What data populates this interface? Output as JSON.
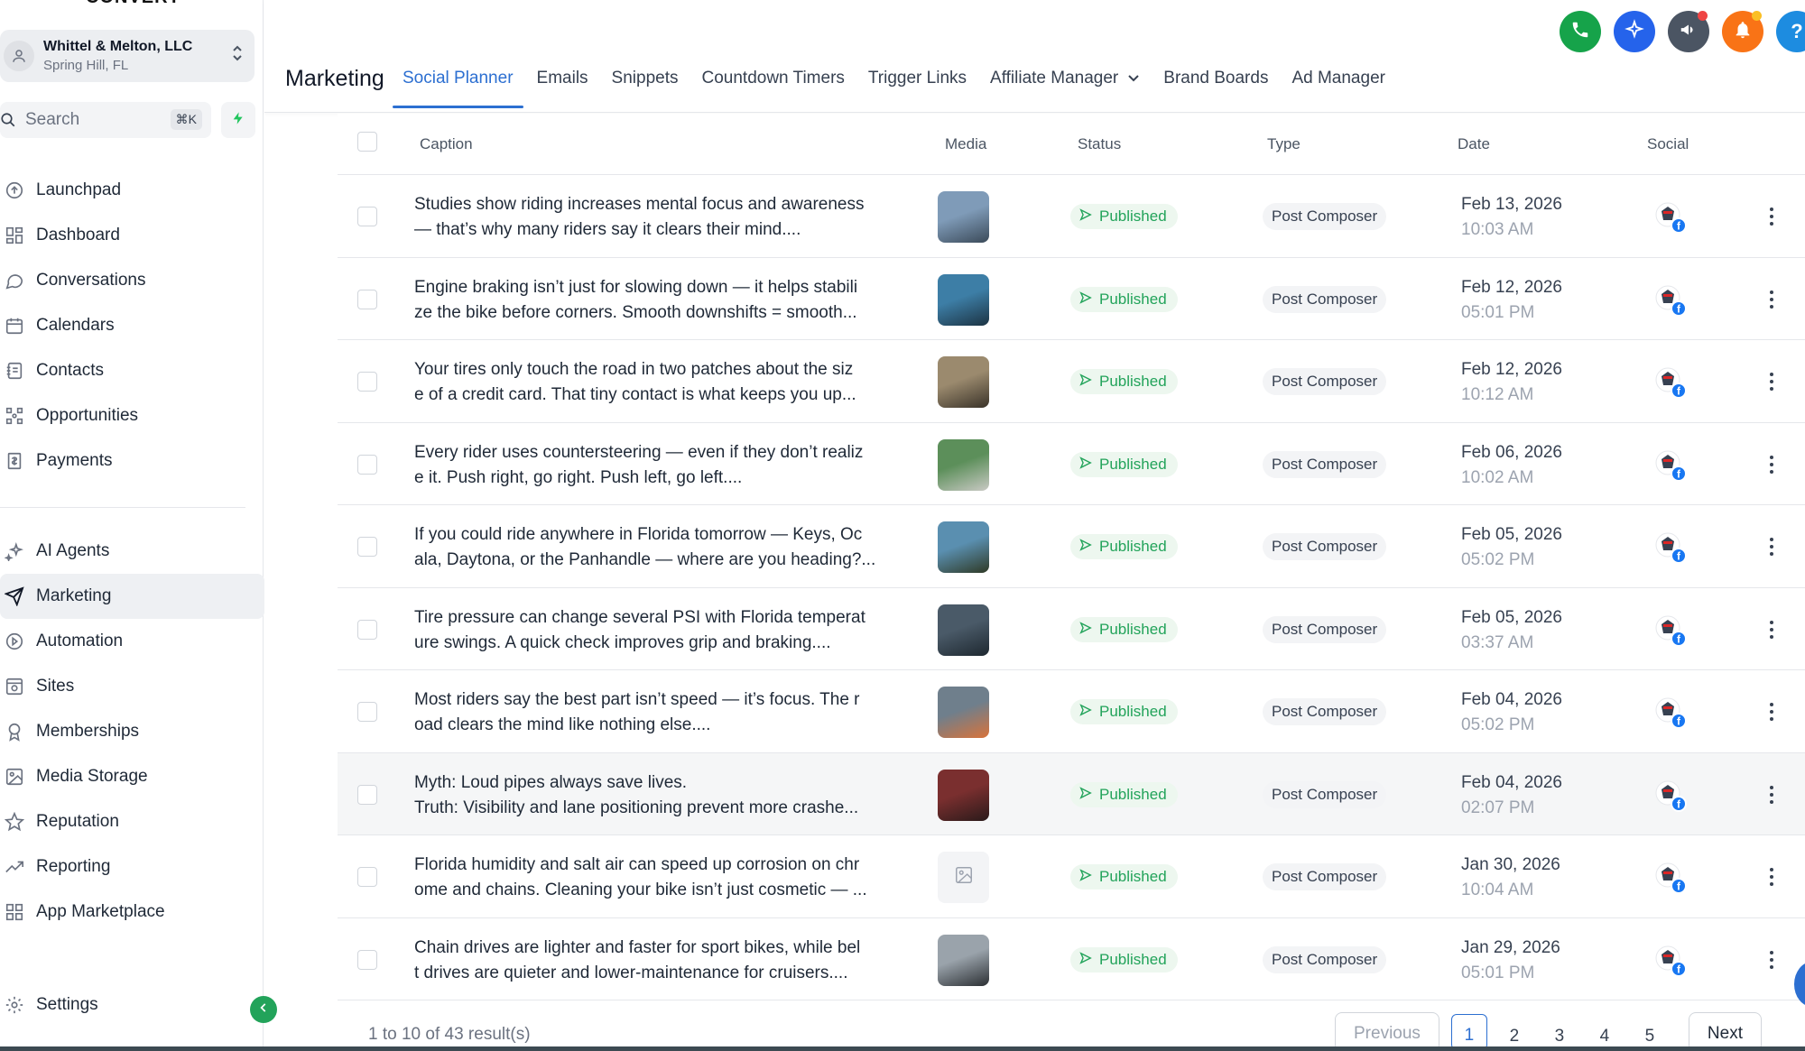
{
  "sidebar": {
    "logo_text": "CONVERT",
    "account": {
      "name": "Whittel & Melton, LLC",
      "location": "Spring Hill, FL"
    },
    "search": {
      "label": "Search",
      "shortcut": "⌘K"
    },
    "items_top": [
      {
        "label": "Launchpad",
        "icon": "rocket-icon"
      },
      {
        "label": "Dashboard",
        "icon": "grid-icon"
      },
      {
        "label": "Conversations",
        "icon": "chat-icon"
      },
      {
        "label": "Calendars",
        "icon": "calendar-icon"
      },
      {
        "label": "Contacts",
        "icon": "contacts-icon"
      },
      {
        "label": "Opportunities",
        "icon": "opportunities-icon"
      },
      {
        "label": "Payments",
        "icon": "payments-icon"
      }
    ],
    "items_bottom": [
      {
        "label": "AI Agents",
        "icon": "sparkle-icon"
      },
      {
        "label": "Marketing",
        "icon": "send-icon",
        "active": true
      },
      {
        "label": "Automation",
        "icon": "automation-icon"
      },
      {
        "label": "Sites",
        "icon": "sites-icon"
      },
      {
        "label": "Memberships",
        "icon": "award-icon"
      },
      {
        "label": "Media Storage",
        "icon": "image-icon"
      },
      {
        "label": "Reputation",
        "icon": "star-icon"
      },
      {
        "label": "Reporting",
        "icon": "trend-icon"
      },
      {
        "label": "App Marketplace",
        "icon": "apps-icon"
      }
    ],
    "settings_label": "Settings"
  },
  "header": {
    "title": "Marketing",
    "tabs": [
      {
        "label": "Social Planner",
        "active": true
      },
      {
        "label": "Emails"
      },
      {
        "label": "Snippets"
      },
      {
        "label": "Countdown Timers"
      },
      {
        "label": "Trigger Links"
      },
      {
        "label": "Affiliate Manager",
        "dropdown": true
      },
      {
        "label": "Brand Boards"
      },
      {
        "label": "Ad Manager"
      }
    ],
    "colors": {
      "phone": "#16a34a",
      "ai": "#2563eb",
      "announce": "#4b5563",
      "notify": "#f97316",
      "help": "#1d8ce0",
      "accent": "#2c6fd1"
    }
  },
  "table": {
    "columns": [
      "Caption",
      "Media",
      "Status",
      "Type",
      "Date",
      "Social"
    ],
    "rows": [
      {
        "line1": "Studies show riding increases mental focus and awareness",
        "line2": "— that’s why many riders say it clears their mind....",
        "status": "Published",
        "type": "Post Composer",
        "date": "Feb 13, 2026",
        "time": "10:03 AM",
        "media": "photo",
        "thumb": [
          "#7f9bb8",
          "#3b4a59"
        ]
      },
      {
        "line1": "Engine braking isn’t just for slowing down — it helps stabili",
        "line2": "ze the bike before corners. Smooth downshifts = smooth...",
        "status": "Published",
        "type": "Post Composer",
        "date": "Feb 12, 2026",
        "time": "05:01 PM",
        "media": "photo",
        "thumb": [
          "#3d7ea6",
          "#1c3343"
        ]
      },
      {
        "line1": "Your tires only touch the road in two patches about the siz",
        "line2": "e of a credit card. That tiny contact is what keeps you up...",
        "status": "Published",
        "type": "Post Composer",
        "date": "Feb 12, 2026",
        "time": "10:12 AM",
        "media": "photo",
        "thumb": [
          "#9b8a6e",
          "#3a3329"
        ]
      },
      {
        "line1": "Every rider uses countersteering — even if they don’t realiz",
        "line2": "e it. Push right, go right. Push left, go left....",
        "status": "Published",
        "type": "Post Composer",
        "date": "Feb 06, 2026",
        "time": "10:02 AM",
        "media": "photo",
        "thumb": [
          "#5c8f5a",
          "#c9c9c4"
        ]
      },
      {
        "line1": "If you could ride anywhere in Florida tomorrow — Keys, Oc",
        "line2": "ala, Daytona, or the Panhandle — where are you heading?...",
        "status": "Published",
        "type": "Post Composer",
        "date": "Feb 05, 2026",
        "time": "05:02 PM",
        "media": "photo",
        "thumb": [
          "#5a8fb0",
          "#2f3a26"
        ]
      },
      {
        "line1": "Tire pressure can change several PSI with Florida temperat",
        "line2": "ure swings. A quick check improves grip and braking....",
        "status": "Published",
        "type": "Post Composer",
        "date": "Feb 05, 2026",
        "time": "03:37 AM",
        "media": "photo",
        "thumb": [
          "#4a5a68",
          "#1e2830"
        ]
      },
      {
        "line1": "Most riders say the best part isn’t speed — it’s focus. The r",
        "line2": "oad clears the mind like nothing else....",
        "status": "Published",
        "type": "Post Composer",
        "date": "Feb 04, 2026",
        "time": "05:02 PM",
        "media": "photo",
        "thumb": [
          "#6f7f8c",
          "#d9733a"
        ]
      },
      {
        "line1": "Myth: Loud pipes always save lives.",
        "line2": "Truth: Visibility and lane positioning prevent more crashe...",
        "status": "Published",
        "type": "Post Composer",
        "date": "Feb 04, 2026",
        "time": "02:07 PM",
        "media": "photo",
        "thumb": [
          "#7a2f2f",
          "#2a1a1a"
        ],
        "highlighted": true
      },
      {
        "line1": "Florida humidity and salt air can speed up corrosion on chr",
        "line2": "ome and chains. Cleaning your bike isn’t just cosmetic — ...",
        "status": "Published",
        "type": "Post Composer",
        "date": "Jan 30, 2026",
        "time": "10:04 AM",
        "media": "placeholder",
        "thumb": [
          "#f3f4f6",
          "#f3f4f6"
        ]
      },
      {
        "line1": "Chain drives are lighter and faster for sport bikes, while bel",
        "line2": "t drives are quieter and lower-maintenance for cruisers....",
        "status": "Published",
        "type": "Post Composer",
        "date": "Jan 29, 2026",
        "time": "05:01 PM",
        "media": "photo",
        "thumb": [
          "#9aa3ab",
          "#2b2f33"
        ]
      }
    ]
  },
  "footer": {
    "results": "1 to 10 of 43 result(s)",
    "previous": "Previous",
    "pages": [
      "1",
      "2",
      "3",
      "4",
      "5"
    ],
    "current_page": "1",
    "next": "Next"
  }
}
